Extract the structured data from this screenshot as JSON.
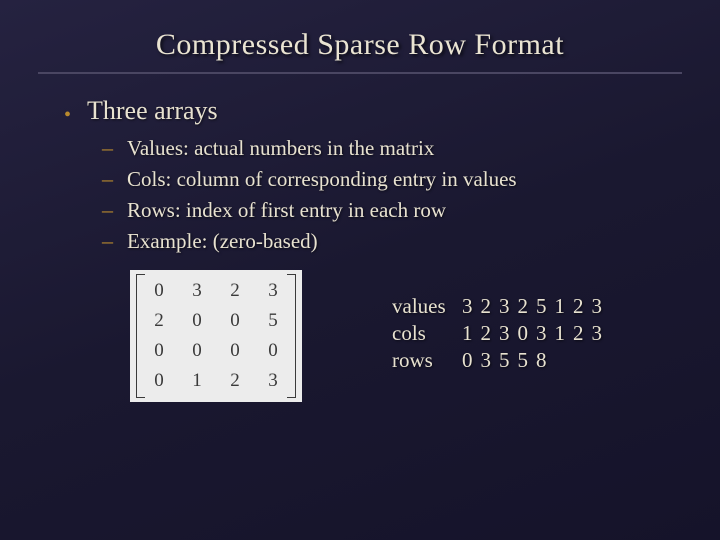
{
  "title": "Compressed Sparse Row Format",
  "bullets": [
    {
      "text": "Three arrays",
      "subs": [
        "Values: actual numbers in the matrix",
        "Cols: column of corresponding entry in values",
        "Rows: index of first entry in each row",
        "Example: (zero-based)"
      ]
    }
  ],
  "matrix": [
    [
      0,
      3,
      2,
      3
    ],
    [
      2,
      0,
      0,
      5
    ],
    [
      0,
      0,
      0,
      0
    ],
    [
      0,
      1,
      2,
      3
    ]
  ],
  "arrays": {
    "values": {
      "label": "values",
      "data": [
        3,
        2,
        3,
        2,
        5,
        1,
        2,
        3
      ]
    },
    "cols": {
      "label": "cols",
      "data": [
        1,
        2,
        3,
        0,
        3,
        1,
        2,
        3
      ]
    },
    "rows": {
      "label": "rows",
      "data": [
        0,
        3,
        5,
        5,
        8
      ]
    }
  }
}
